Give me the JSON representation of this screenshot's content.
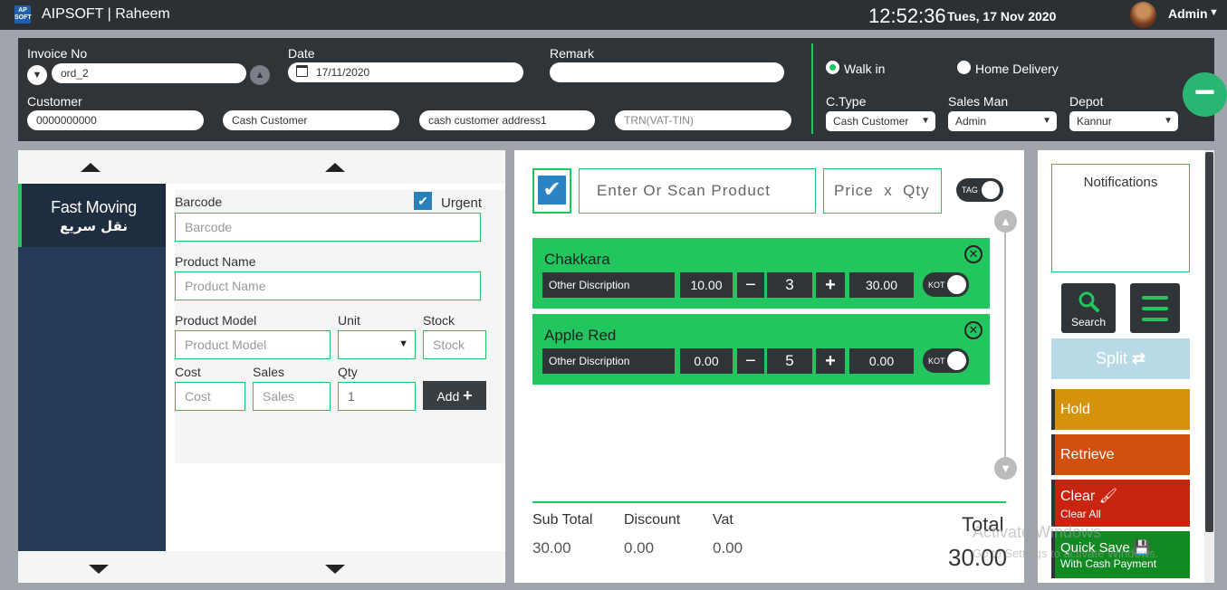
{
  "topbar": {
    "logo_text": "AP SOFT",
    "app_title": "AIPSOFT | Raheem",
    "time": "12:52:36",
    "date": "Tues, 17 Nov 2020",
    "user": "Admin"
  },
  "header": {
    "invoice_label": "Invoice No",
    "invoice_value": "ord_2",
    "date_label": "Date",
    "date_value": "17/11/2020",
    "remark_label": "Remark",
    "remark_value": "",
    "customer_label": "Customer",
    "customer_code": "0000000000",
    "customer_name": "Cash Customer",
    "customer_address": "cash customer address1",
    "trn_placeholder": "TRN(VAT-TIN)",
    "walk_in_label": "Walk in",
    "home_delivery_label": "Home Delivery",
    "walk_in_selected": true,
    "ctype_label": "C.Type",
    "ctype_value": "Cash Customer",
    "salesman_label": "Sales Man",
    "salesman_value": "Admin",
    "depot_label": "Depot",
    "depot_value": "Kannur"
  },
  "left_panel": {
    "category_name": "Fast Moving",
    "category_name_ar": "نقل سريع",
    "barcode_label": "Barcode",
    "barcode_placeholder": "Barcode",
    "urgent_label": "Urgent",
    "urgent_checked": true,
    "product_name_label": "Product Name",
    "product_name_placeholder": "Product Name",
    "product_model_label": "Product Model",
    "product_model_placeholder": "Product Model",
    "unit_label": "Unit",
    "stock_label": "Stock",
    "stock_placeholder": "Stock",
    "cost_label": "Cost",
    "cost_placeholder": "Cost",
    "sales_label": "Sales",
    "sales_placeholder": "Sales",
    "qty_label": "Qty",
    "qty_value": "1",
    "add_label": "Add"
  },
  "center": {
    "scan_placeholder": "Enter Or Scan Product",
    "price_label": "Price",
    "x_label": "x",
    "qty_label": "Qty",
    "tag_label": "TAG",
    "items": [
      {
        "name": "Chakkara",
        "desc": "Other Discription",
        "price": "10.00",
        "qty": "3",
        "total": "30.00",
        "kot": "KOT"
      },
      {
        "name": "Apple Red",
        "desc": "Other Discription",
        "price": "0.00",
        "qty": "5",
        "total": "0.00",
        "kot": "KOT"
      }
    ],
    "subtotal_label": "Sub Total",
    "subtotal_value": "30.00",
    "discount_label": "Discount",
    "discount_value": "0.00",
    "vat_label": "Vat",
    "vat_value": "0.00",
    "total_label": "Total",
    "total_value": "30.00"
  },
  "right_panel": {
    "notifications_label": "Notifications",
    "search_label": "Search",
    "split_label": "Split",
    "hold_label": "Hold",
    "retrieve_label": "Retrieve",
    "clear_label": "Clear",
    "clear_sub": "Clear All",
    "quicksave_label": "Quick Save",
    "quicksave_sub": "With Cash Payment"
  },
  "watermark": {
    "line1": "Activate Windows",
    "line2": "Go to Settings to activate Windows."
  },
  "colors": {
    "accent": "#22c55e",
    "dark": "#2f3439",
    "hold": "#d4930a",
    "retrieve": "#d2500d",
    "clear": "#c8240f",
    "quicksave": "#128a22",
    "split": "#b7dae6"
  }
}
